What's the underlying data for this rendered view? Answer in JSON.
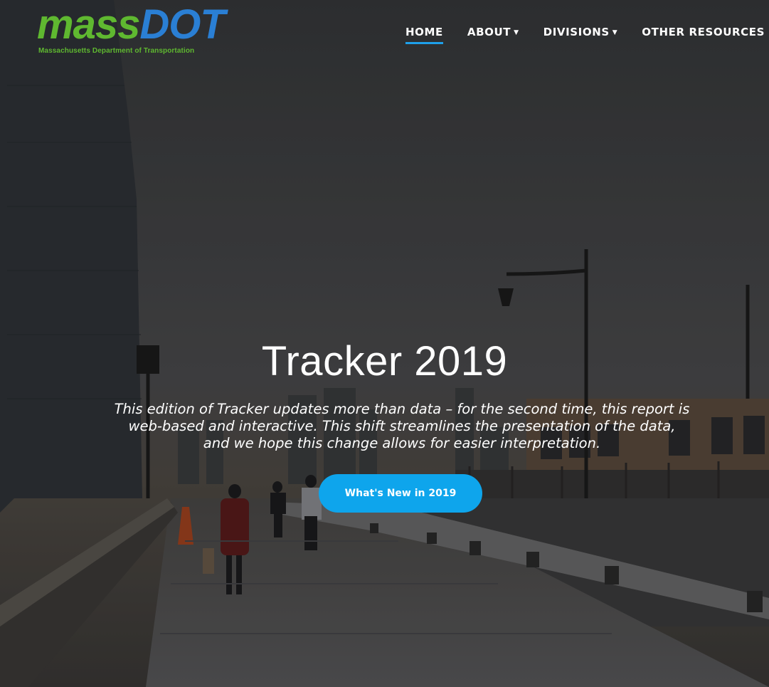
{
  "header": {
    "logo": {
      "wordmark_primary": "mass",
      "wordmark_secondary": "DOT",
      "subtitle": "Massachusetts Department of Transportation"
    },
    "nav": [
      {
        "label": "HOME",
        "active": true,
        "has_dropdown": false
      },
      {
        "label": "ABOUT",
        "active": false,
        "has_dropdown": true
      },
      {
        "label": "DIVISIONS",
        "active": false,
        "has_dropdown": true
      },
      {
        "label": "OTHER RESOURCES",
        "active": false,
        "has_dropdown": false
      }
    ]
  },
  "hero": {
    "title": "Tracker 2019",
    "description": "This edition of Tracker updates more than data – for the second time, this report is web-based and interactive. This shift streamlines the presentation of the data, and we hope this change allows for easier interpretation.",
    "cta_label": "What's New in 2019"
  },
  "colors": {
    "accent": "#0ea5ec",
    "nav_underline": "#1ea0ea",
    "logo_green": "#5fb830",
    "logo_blue": "#2a7fd4"
  }
}
